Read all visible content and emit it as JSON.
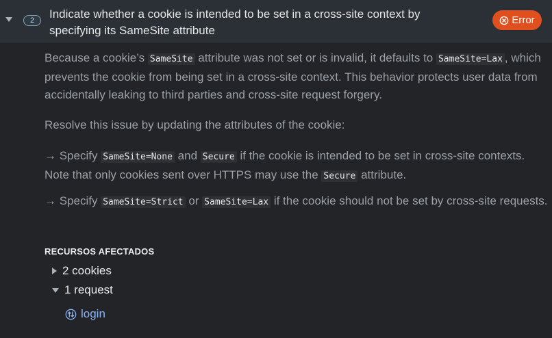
{
  "header": {
    "count": "2",
    "title": "Indicate whether a cookie is intended to be set in a cross-site context by specifying its SameSite attribute",
    "badge_label": "Error",
    "badge_icon": "error-circle-icon",
    "chevron_icon": "chevron-down-icon"
  },
  "body": {
    "p1": {
      "t1": "Because a cookie’s ",
      "c1": "SameSite",
      "t2": " attribute was not set or is invalid, it defaults to ",
      "c2": "SameSite=Lax",
      "t3": ", which prevents the cookie from being set in a cross-site context. This behavior protects user data from accidentally leaking to third parties and cross-site request forgery."
    },
    "p2": "Resolve this issue by updating the attributes of the cookie:",
    "p3": {
      "t1": "→ Specify ",
      "c1": "SameSite=None",
      "t2": " and ",
      "c2": "Secure",
      "t3": " if the cookie is intended to be set in cross-site contexts. Note that only cookies sent over HTTPS may use the ",
      "c3": "Secure",
      "t4": " attribute."
    },
    "p4": {
      "t1": "→ Specify ",
      "c1": "SameSite=Strict",
      "t2": " or ",
      "c2": "SameSite=Lax",
      "t3": " if the cookie should not be set by cross-site requests."
    }
  },
  "affected": {
    "heading": "RECURSOS AFECTADOS",
    "cookies_label": "2 cookies",
    "requests_label": "1 request",
    "request_link": "login"
  },
  "colors": {
    "error_badge": "#e0501f",
    "link": "#8ab4f8"
  }
}
